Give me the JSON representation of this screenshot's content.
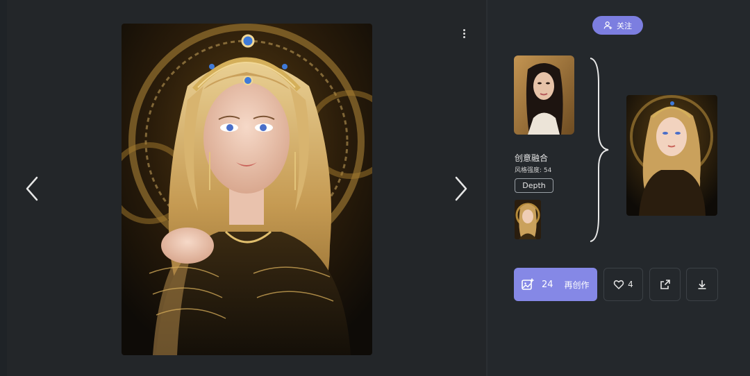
{
  "viewer": {
    "prev_icon": "chevron-left-icon",
    "next_icon": "chevron-right-icon",
    "more_icon": "more-vertical-icon",
    "image_subject": "golden-haired woman with jeweled tiara"
  },
  "profile": {
    "follow_label": "关注",
    "follow_icon": "user-plus-icon"
  },
  "fusion": {
    "title": "创意融合",
    "strength_text": "风格强度: 54",
    "tag": "Depth"
  },
  "actions": {
    "remix_count": "24",
    "remix_label": "再创作",
    "like_count": "4",
    "share_icon": "share-icon",
    "download_icon": "download-icon"
  },
  "colors": {
    "accent": "#8588e6",
    "background": "#1f2327",
    "panel": "#24282c"
  }
}
